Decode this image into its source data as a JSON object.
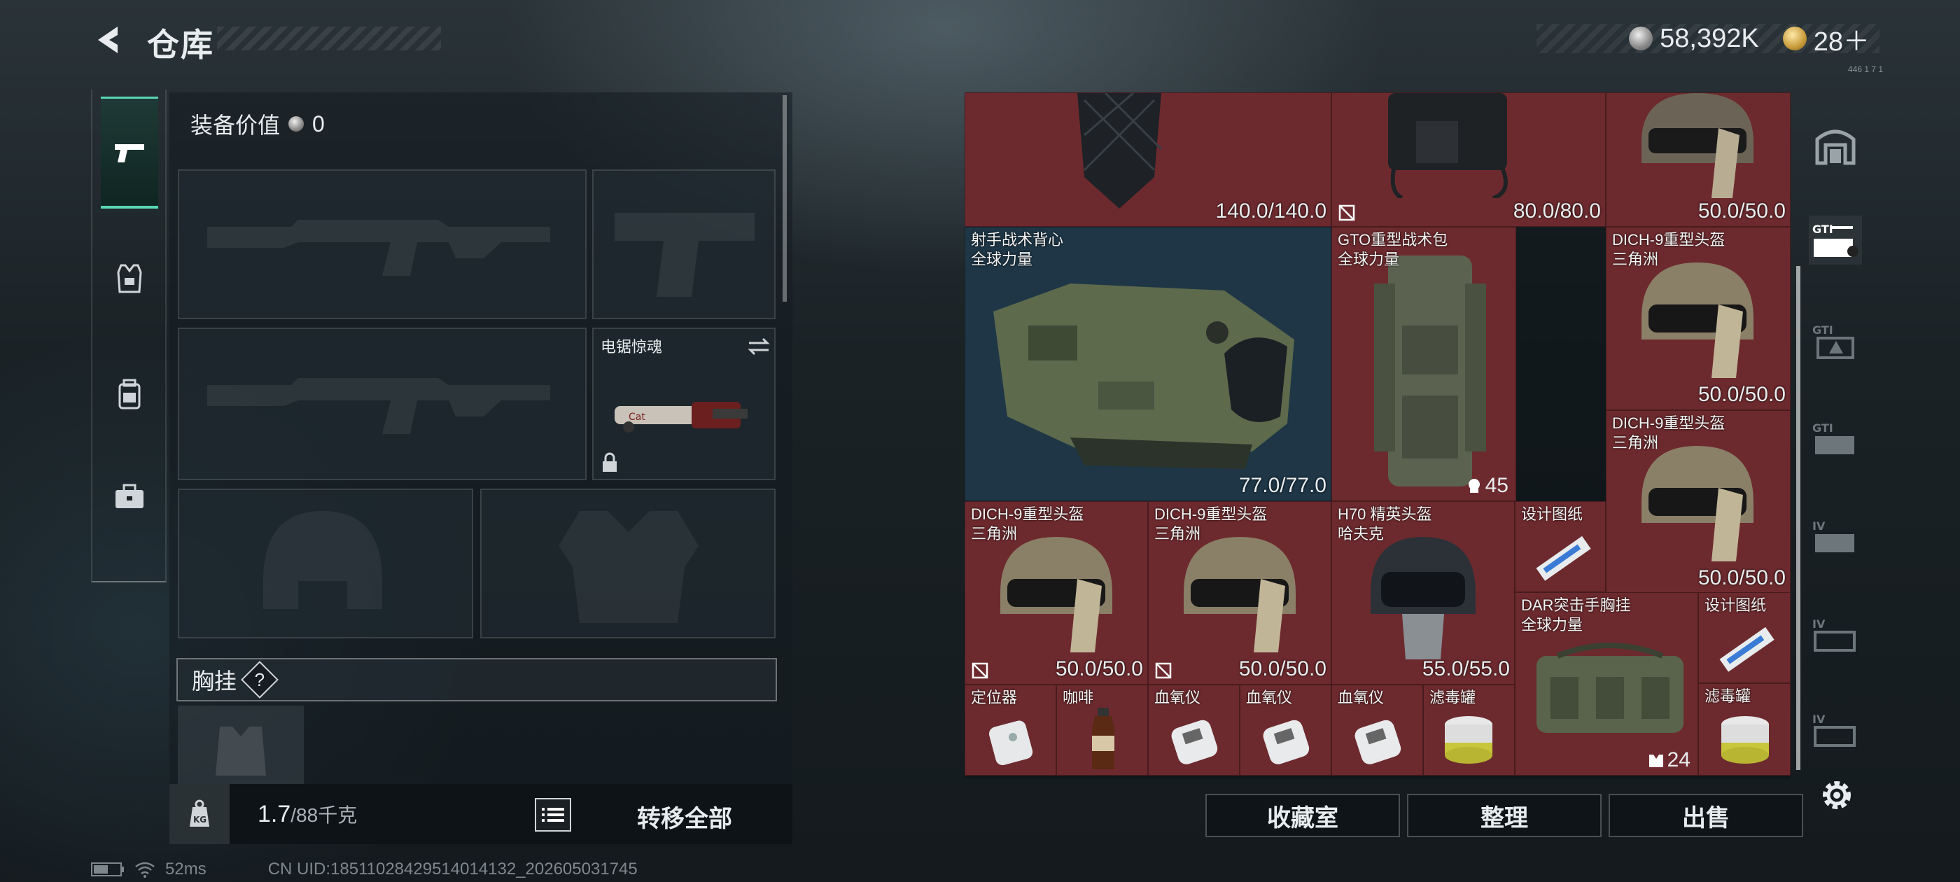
{
  "header": {
    "title": "仓库",
    "currency_silver": "58,392K",
    "currency_gold": "28＋"
  },
  "corner_text": "446 1 7 1",
  "left": {
    "equip_value_label": "装备价值",
    "equip_value": "0",
    "sidearm_slot_name": "电锯惊魂",
    "chest_label": "胸挂",
    "help_glyph": "?",
    "weight": "1.7",
    "weight_capacity": "/88千克",
    "transfer_all": "转移全部"
  },
  "status": {
    "ping": "52ms",
    "uid": "CN UID:18511028429514014132_202605031745"
  },
  "grid": {
    "top": [
      {
        "dur": "140.0/140.0"
      },
      {
        "dur": "80.0/80.0"
      },
      {
        "dur": "50.0/50.0"
      }
    ],
    "vest": {
      "name": "射手战术背心",
      "sub": "全球力量",
      "dur": "77.0/77.0"
    },
    "backpack": {
      "name": "GTO重型战术包",
      "sub": "全球力量",
      "count": "45"
    },
    "helmet_r1": {
      "name": "DICH-9重型头盔",
      "sub": "三角洲",
      "dur": "50.0/50.0"
    },
    "helmet_r2": {
      "name": "DICH-9重型头盔",
      "sub": "三角洲",
      "dur": "50.0/50.0"
    },
    "helmet_b1": {
      "name": "DICH-9重型头盔",
      "sub": "三角洲",
      "dur": "50.0/50.0"
    },
    "helmet_b2": {
      "name": "DICH-9重型头盔",
      "sub": "三角洲",
      "dur": "50.0/50.0"
    },
    "h70": {
      "name": "H70 精英头盔",
      "sub": "哈夫克",
      "dur": "55.0/55.0"
    },
    "blueprint1": {
      "name": "设计图纸"
    },
    "blueprint2": {
      "name": "设计图纸"
    },
    "dar": {
      "name": "DAR突击手胸挂",
      "sub": "全球力量",
      "count": "24"
    },
    "smalls": [
      "定位器",
      "咖啡",
      "血氧仪",
      "血氧仪",
      "血氧仪",
      "滤毒罐"
    ],
    "filter2": "滤毒罐"
  },
  "buttons": {
    "collection": "收藏室",
    "organize": "整理",
    "sell": "出售"
  },
  "colors": {
    "accent": "#59d6b4",
    "red_cell": "#6d2a2e",
    "blue_cell": "#1e3646"
  }
}
